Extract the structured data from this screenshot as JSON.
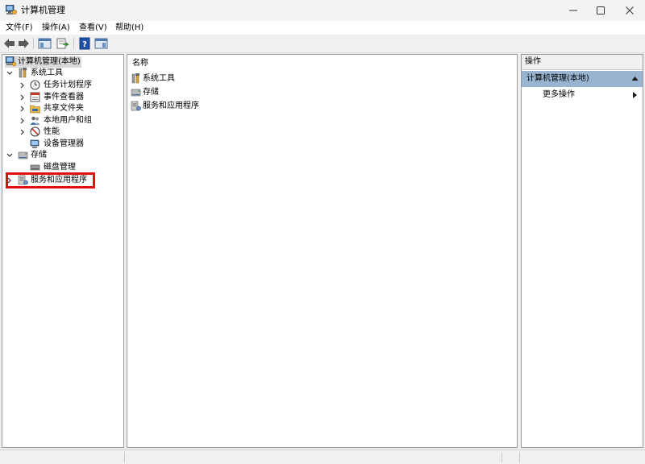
{
  "window": {
    "title": "计算机管理"
  },
  "menu": [
    {
      "label": "文件(F)"
    },
    {
      "label": "操作(A)"
    },
    {
      "label": "查看(V)"
    },
    {
      "label": "帮助(H)"
    }
  ],
  "tree": {
    "root": "计算机管理(本地)",
    "system_tools": "系统工具",
    "task_scheduler": "任务计划程序",
    "event_viewer": "事件查看器",
    "shared_folders": "共享文件夹",
    "local_users": "本地用户和组",
    "performance": "性能",
    "device_manager": "设备管理器",
    "storage": "存储",
    "disk_management": "磁盘管理",
    "services_apps": "服务和应用程序"
  },
  "center": {
    "column_header": "名称",
    "items": [
      {
        "label": "系统工具",
        "icon": "tools-icon"
      },
      {
        "label": "存储",
        "icon": "storage-icon"
      },
      {
        "label": "服务和应用程序",
        "icon": "services-icon"
      }
    ]
  },
  "actions": {
    "header": "操作",
    "section": "计算机管理(本地)",
    "more": "更多操作"
  },
  "colors": {
    "selection": "#d9d9d9",
    "actions_section": "#99b4d1",
    "highlight": "#e01010"
  }
}
